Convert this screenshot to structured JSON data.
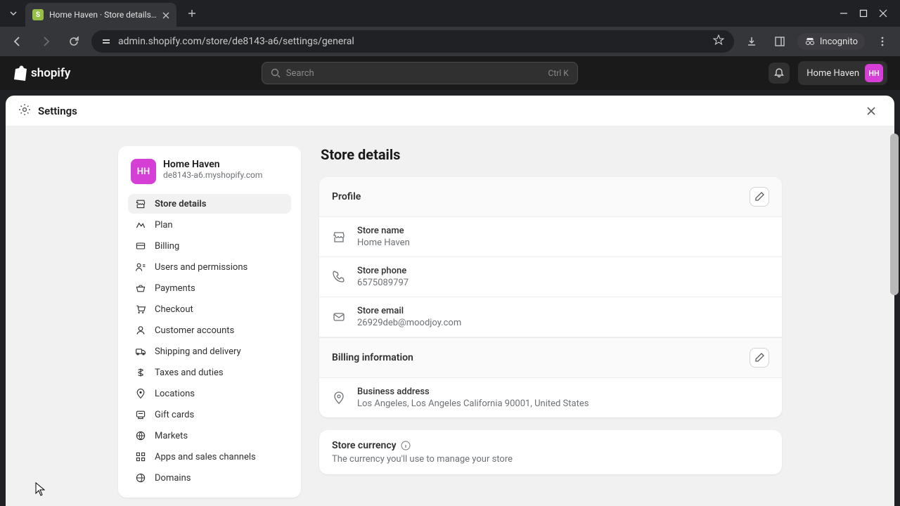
{
  "browser": {
    "tab_title": "Home Haven · Store details · Sh",
    "url": "admin.shopify.com/store/de8143-a6/settings/general",
    "incognito": "Incognito"
  },
  "app": {
    "brand": "shopify",
    "search_placeholder": "Search",
    "search_hint": "Ctrl K",
    "store_name": "Home Haven",
    "store_initials": "HH"
  },
  "settings": {
    "heading": "Settings",
    "store": {
      "name": "Home Haven",
      "initials": "HH",
      "domain": "de8143-a6.myshopify.com"
    },
    "nav": [
      {
        "label": "Store details",
        "active": true
      },
      {
        "label": "Plan"
      },
      {
        "label": "Billing"
      },
      {
        "label": "Users and permissions"
      },
      {
        "label": "Payments"
      },
      {
        "label": "Checkout"
      },
      {
        "label": "Customer accounts"
      },
      {
        "label": "Shipping and delivery"
      },
      {
        "label": "Taxes and duties"
      },
      {
        "label": "Locations"
      },
      {
        "label": "Gift cards"
      },
      {
        "label": "Markets"
      },
      {
        "label": "Apps and sales channels"
      },
      {
        "label": "Domains"
      }
    ]
  },
  "page": {
    "title": "Store details",
    "profile": {
      "heading": "Profile",
      "name_label": "Store name",
      "name_value": "Home Haven",
      "phone_label": "Store phone",
      "phone_value": "6575089797",
      "email_label": "Store email",
      "email_value": "26929deb@moodjoy.com"
    },
    "billing": {
      "heading": "Billing information",
      "addr_label": "Business address",
      "addr_value": "Los Angeles, Los Angeles California 90001, United States"
    },
    "currency": {
      "heading": "Store currency",
      "sub": "The currency you'll use to manage your store"
    }
  }
}
